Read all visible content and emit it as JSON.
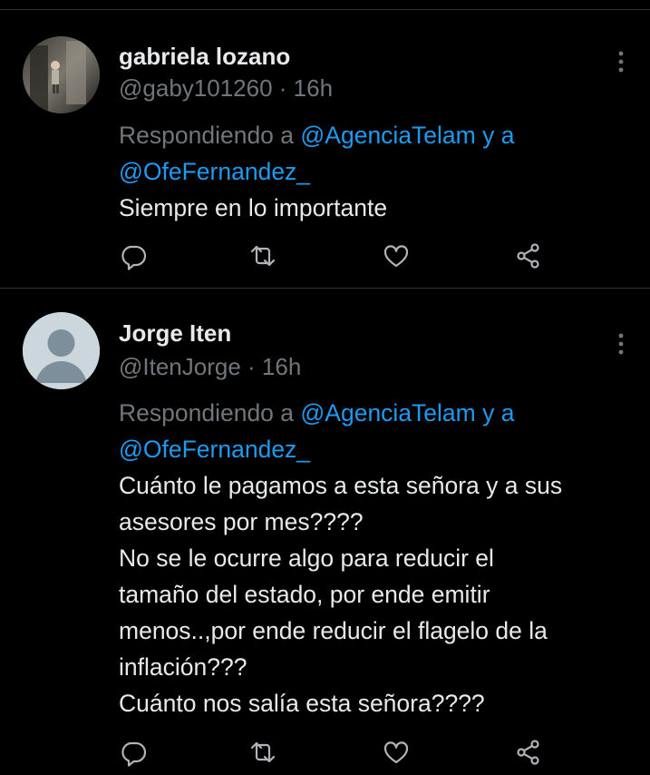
{
  "tweets": [
    {
      "display_name": "gabriela lozano",
      "handle": "@gaby101260",
      "separator": " · ",
      "time": "16h",
      "replying_to_prefix": "Respondiendo a ",
      "mention_1": "@AgenciaTelam",
      "reply_conjunction": " y a",
      "mention_2": "@OfeFernandez_",
      "text_lines": [
        "Siempre en lo importante"
      ],
      "avatar": "user-photo"
    },
    {
      "display_name": "Jorge Iten",
      "handle": "@ItenJorge",
      "separator": " · ",
      "time": "16h",
      "replying_to_prefix": "Respondiendo a ",
      "mention_1": "@AgenciaTelam",
      "reply_conjunction": " y a",
      "mention_2": "@OfeFernandez_",
      "text_lines": [
        "Cuánto le pagamos a esta señora y a sus",
        "asesores por mes????",
        "No se le ocurre algo para reducir el",
        "tamaño del estado, por ende emitir",
        "menos..,por ende reducir el flagelo de la",
        "inflación???",
        "Cuánto nos salía esta señora????"
      ],
      "avatar": "default-avatar"
    }
  ],
  "icons": {
    "reply": "reply-icon",
    "retweet": "retweet-icon",
    "like": "heart-icon",
    "share": "share-icon",
    "more": "more-vertical-icon"
  },
  "colors": {
    "background": "#000000",
    "text_primary": "#e7e9ea",
    "text_secondary": "#71767b",
    "link": "#1d9bf0",
    "divider": "#2f3336",
    "default_avatar": "#ccd6dd"
  }
}
